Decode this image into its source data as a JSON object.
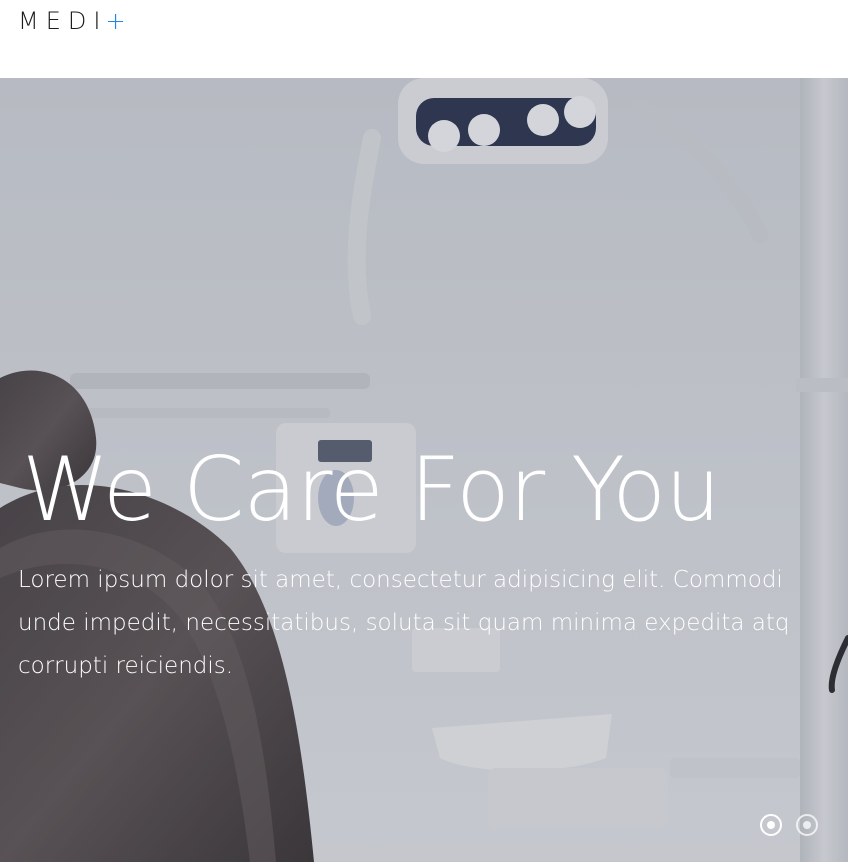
{
  "header": {
    "logo_text": "MEDI",
    "logo_symbol": "+",
    "accent_color": "#1e88e5"
  },
  "hero": {
    "headline": "We Care For You",
    "subtext_lines": [
      "Lorem ipsum dolor sit amet, consectetur adipisicing elit. Commodi",
      "unde impedit, necessitatibus, soluta sit quam minima expedita atq",
      "corrupti reiciendis."
    ],
    "background_image": "dental-clinic-chair-photo",
    "slider": {
      "slides": 2,
      "active_index": 0
    }
  }
}
